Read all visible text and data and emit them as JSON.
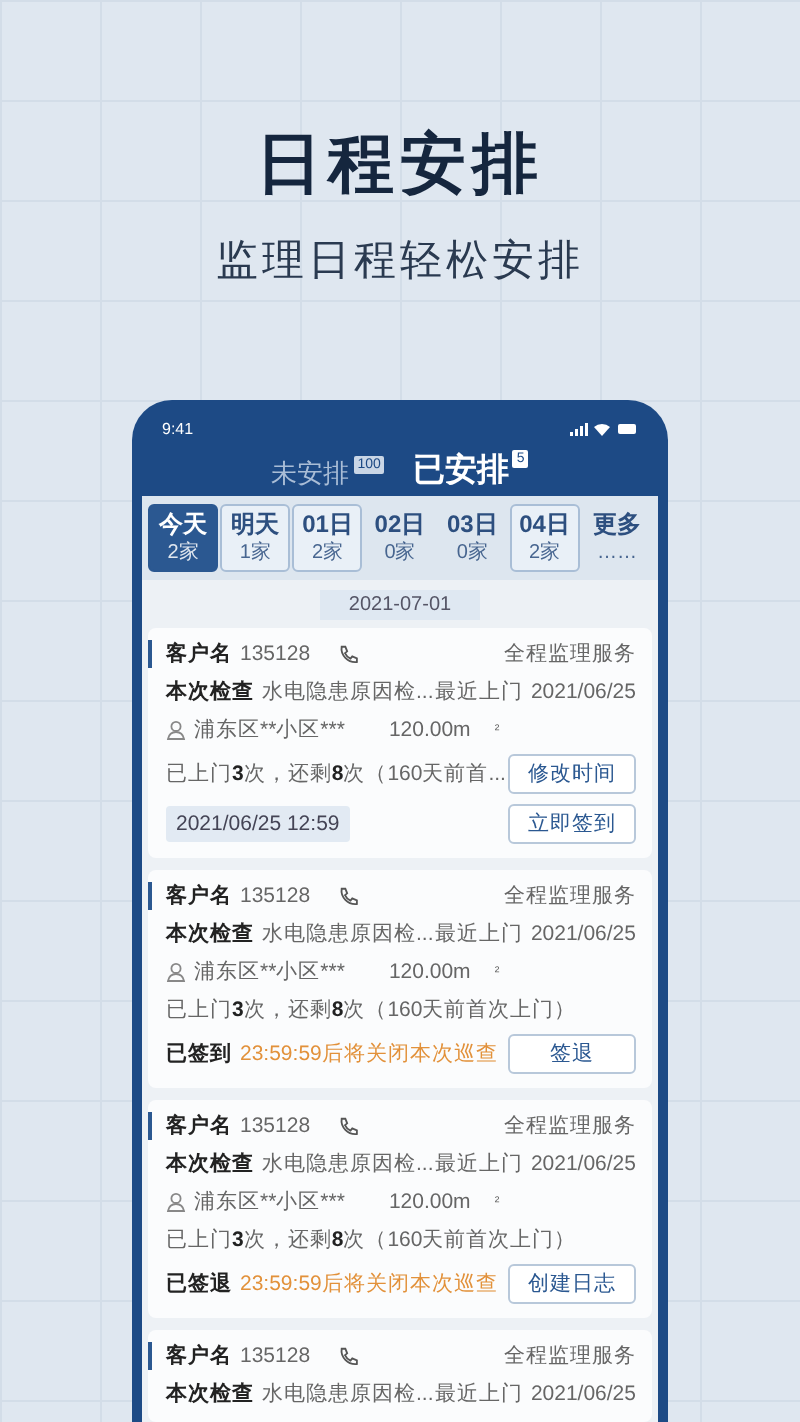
{
  "promo": {
    "title": "日程安排",
    "subtitle": "监理日程轻松安排"
  },
  "status_bar": {
    "time": "9:41"
  },
  "tabs": [
    {
      "label": "未安排",
      "badge": "100",
      "selected": false
    },
    {
      "label": "已安排",
      "badge": "5",
      "selected": true
    }
  ],
  "days": [
    {
      "label": "今天",
      "count": "2家",
      "selected": true,
      "outlined": true
    },
    {
      "label": "明天",
      "count": "1家",
      "selected": false,
      "outlined": true
    },
    {
      "label": "01日",
      "count": "2家",
      "selected": false,
      "outlined": true
    },
    {
      "label": "02日",
      "count": "0家",
      "selected": false,
      "outlined": false
    },
    {
      "label": "03日",
      "count": "0家",
      "selected": false,
      "outlined": false
    },
    {
      "label": "04日",
      "count": "2家",
      "selected": false,
      "outlined": true
    },
    {
      "label": "更多",
      "count": "……",
      "selected": false,
      "outlined": false
    }
  ],
  "date_header": "2021-07-01",
  "cards": [
    {
      "kind": "reschedule",
      "customer_label": "客户名",
      "customer_id": "135128",
      "service": "全程监理服务",
      "inspection_label": "本次检查",
      "inspection": "水电隐患原因检...",
      "last_visit_label": "最近上门",
      "last_visit": "2021/06/25",
      "address": "浦东区**小区***",
      "area": "120.00m",
      "area_unit": "²",
      "visits": "已上门**3**次，还剩**8**次（160天前首...",
      "time": "2021/06/25 12:59",
      "buttons": [
        "修改时间",
        "立即签到"
      ]
    },
    {
      "kind": "status",
      "customer_label": "客户名",
      "customer_id": "135128",
      "service": "全程监理服务",
      "inspection_label": "本次检查",
      "inspection": "水电隐患原因检...",
      "last_visit_label": "最近上门",
      "last_visit": "2021/06/25",
      "address": "浦东区**小区***",
      "area": "120.00m",
      "area_unit": "²",
      "visits": "已上门**3**次，还剩**8**次（160天前首次上门）",
      "status": "已签到",
      "countdown": "23:59:59后将关闭本次巡查",
      "buttons": [
        "签退"
      ]
    },
    {
      "kind": "status",
      "customer_label": "客户名",
      "customer_id": "135128",
      "service": "全程监理服务",
      "inspection_label": "本次检查",
      "inspection": "水电隐患原因检...",
      "last_visit_label": "最近上门",
      "last_visit": "2021/06/25",
      "address": "浦东区**小区***",
      "area": "120.00m",
      "area_unit": "²",
      "visits": "已上门**3**次，还剩**8**次（160天前首次上门）",
      "status": "已签退",
      "countdown": "23:59:59后将关闭本次巡查",
      "buttons": [
        "创建日志"
      ]
    },
    {
      "kind": "partial",
      "customer_label": "客户名",
      "customer_id": "135128",
      "service": "全程监理服务",
      "inspection_label": "本次检查",
      "inspection": "水电隐患原因检...",
      "last_visit_label": "最近上门",
      "last_visit": "2021/06/25"
    }
  ]
}
